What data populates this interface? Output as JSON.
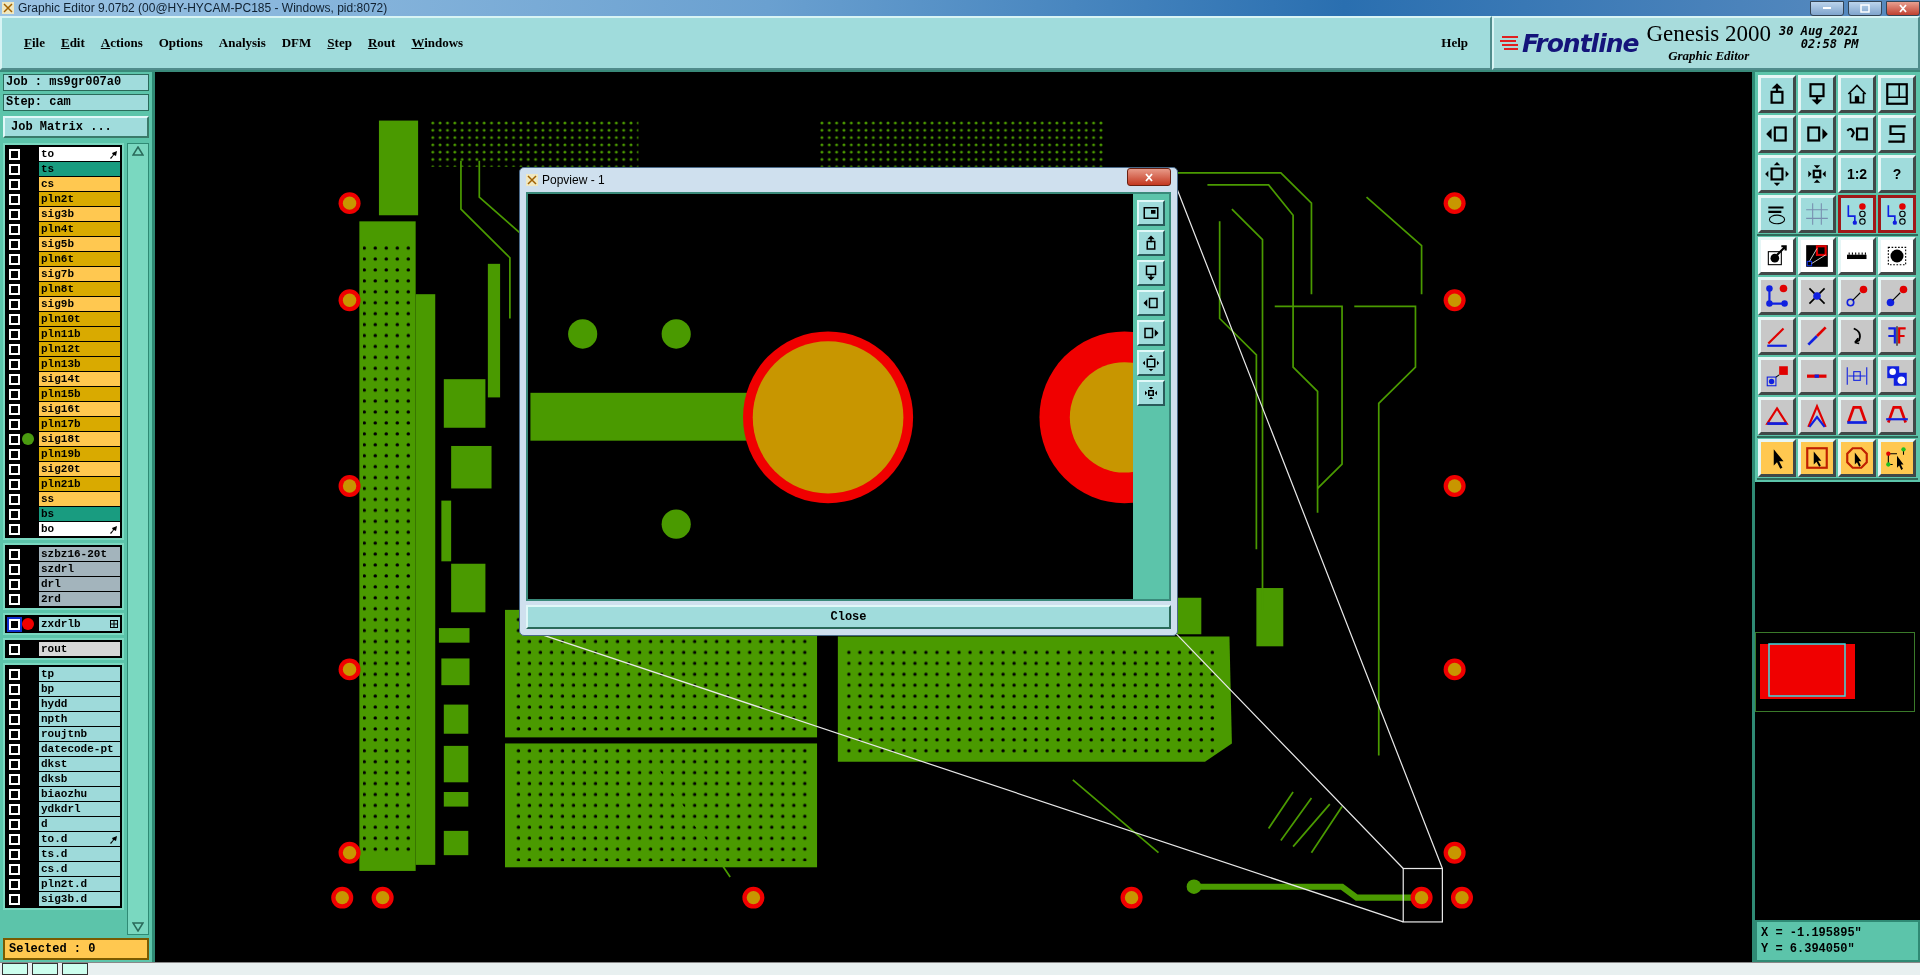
{
  "window": {
    "title": "Graphic Editor 9.07b2 (00@HY-HYCAM-PC185 - Windows, pid:8072)"
  },
  "menu": [
    {
      "label": "File",
      "underline": true
    },
    {
      "label": "Edit",
      "underline": true
    },
    {
      "label": "Actions",
      "underline": true
    },
    {
      "label": "Options",
      "underline": false
    },
    {
      "label": "Analysis",
      "underline": false
    },
    {
      "label": "DFM",
      "underline": false
    },
    {
      "label": "Step",
      "underline": true
    },
    {
      "label": "Rout",
      "underline": true
    },
    {
      "label": "Windows",
      "underline": true
    }
  ],
  "help": {
    "label": "Help"
  },
  "brand": {
    "logo": "Frontline",
    "product": "Genesis 2000",
    "subtitle": "Graphic Editor",
    "date": "30 Aug 2021",
    "time": "02:58 PM"
  },
  "job": {
    "job": "Job : ms9gr007a0",
    "step": "Step: cam",
    "matrix_button": "Job Matrix ..."
  },
  "layer_groups": [
    {
      "rows": [
        {
          "name": "to",
          "kind": "hand",
          "color": "#ffffff",
          "affected": false,
          "displayed": false,
          "work_layer": false
        },
        {
          "name": "ts",
          "kind": "plain",
          "color": "#199c80",
          "affected": false,
          "displayed": false,
          "work_layer": false
        },
        {
          "name": "cs",
          "kind": "plain",
          "color": "#ffc850",
          "affected": false,
          "displayed": false,
          "work_layer": false
        },
        {
          "name": "pln2t",
          "kind": "plain",
          "color": "#d9aa00",
          "affected": false,
          "displayed": false,
          "work_layer": false
        },
        {
          "name": "sig3b",
          "kind": "plain",
          "color": "#ffc850",
          "affected": false,
          "displayed": false,
          "work_layer": false
        },
        {
          "name": "pln4t",
          "kind": "plain",
          "color": "#d9aa00",
          "affected": false,
          "displayed": false,
          "work_layer": false
        },
        {
          "name": "sig5b",
          "kind": "plain",
          "color": "#ffc850",
          "affected": false,
          "displayed": false,
          "work_layer": false
        },
        {
          "name": "pln6t",
          "kind": "plain",
          "color": "#d9aa00",
          "affected": false,
          "displayed": false,
          "work_layer": false
        },
        {
          "name": "sig7b",
          "kind": "plain",
          "color": "#ffc850",
          "affected": false,
          "displayed": false,
          "work_layer": false
        },
        {
          "name": "pln8t",
          "kind": "plain",
          "color": "#d9aa00",
          "affected": false,
          "displayed": false,
          "work_layer": false
        },
        {
          "name": "sig9b",
          "kind": "plain",
          "color": "#ffc850",
          "affected": false,
          "displayed": false,
          "work_layer": false
        },
        {
          "name": "pln10t",
          "kind": "plain",
          "color": "#d9aa00",
          "affected": false,
          "displayed": false,
          "work_layer": false
        },
        {
          "name": "pln11b",
          "kind": "plain",
          "color": "#d9aa00",
          "affected": false,
          "displayed": false,
          "work_layer": false
        },
        {
          "name": "pln12t",
          "kind": "plain",
          "color": "#d9aa00",
          "affected": false,
          "displayed": false,
          "work_layer": false
        },
        {
          "name": "pln13b",
          "kind": "plain",
          "color": "#d9aa00",
          "affected": false,
          "displayed": false,
          "work_layer": false
        },
        {
          "name": "sig14t",
          "kind": "plain",
          "color": "#ffc850",
          "affected": false,
          "displayed": false,
          "work_layer": false
        },
        {
          "name": "pln15b",
          "kind": "plain",
          "color": "#d9aa00",
          "affected": false,
          "displayed": false,
          "work_layer": false
        },
        {
          "name": "sig16t",
          "kind": "plain",
          "color": "#ffc850",
          "affected": false,
          "displayed": false,
          "work_layer": false
        },
        {
          "name": "pln17b",
          "kind": "plain",
          "color": "#d9aa00",
          "affected": false,
          "displayed": false,
          "work_layer": false
        },
        {
          "name": "sig18t",
          "kind": "plain",
          "color": "#ffc850",
          "affected": false,
          "displayed": true,
          "work_layer": false
        },
        {
          "name": "pln19b",
          "kind": "plain",
          "color": "#d9aa00",
          "affected": false,
          "displayed": false,
          "work_layer": false
        },
        {
          "name": "sig20t",
          "kind": "plain",
          "color": "#ffc850",
          "affected": false,
          "displayed": false,
          "work_layer": false
        },
        {
          "name": "pln21b",
          "kind": "plain",
          "color": "#d9aa00",
          "affected": false,
          "displayed": false,
          "work_layer": false
        },
        {
          "name": "ss",
          "kind": "plain",
          "color": "#ffc850",
          "affected": false,
          "displayed": false,
          "work_layer": false
        },
        {
          "name": "bs",
          "kind": "plain",
          "color": "#199c80",
          "affected": false,
          "displayed": false,
          "work_layer": false
        },
        {
          "name": "bo",
          "kind": "hand",
          "color": "#ffffff",
          "affected": false,
          "displayed": false,
          "work_layer": false
        }
      ]
    },
    {
      "rows": [
        {
          "name": "szbz16-20t",
          "kind": "plain",
          "color": "#a3b4bc",
          "affected": false,
          "displayed": false,
          "work_layer": false
        },
        {
          "name": "szdrl",
          "kind": "plain",
          "color": "#a3b4bc",
          "affected": false,
          "displayed": false,
          "work_layer": false
        },
        {
          "name": "drl",
          "kind": "plain",
          "color": "#a3b4bc",
          "affected": false,
          "displayed": false,
          "work_layer": false
        },
        {
          "name": "2rd",
          "kind": "plain",
          "color": "#a3b4bc",
          "affected": false,
          "displayed": false,
          "work_layer": false
        }
      ]
    },
    {
      "rows": [
        {
          "name": "zxdrlb",
          "kind": "grid",
          "color": "#9edada",
          "affected": false,
          "displayed": false,
          "work_layer": true
        }
      ]
    },
    {
      "rows": [
        {
          "name": "rout",
          "kind": "plain",
          "color": "#d8d8d8",
          "affected": false,
          "displayed": false,
          "work_layer": false
        }
      ]
    },
    {
      "rows": [
        {
          "name": "tp",
          "kind": "plain",
          "color": "#9edada",
          "affected": false,
          "displayed": false,
          "work_layer": false
        },
        {
          "name": "bp",
          "kind": "plain",
          "color": "#9edada",
          "affected": false,
          "displayed": false,
          "work_layer": false
        },
        {
          "name": "hydd",
          "kind": "plain",
          "color": "#9edada",
          "affected": false,
          "displayed": false,
          "work_layer": false
        },
        {
          "name": "npth",
          "kind": "plain",
          "color": "#9edada",
          "affected": false,
          "displayed": false,
          "work_layer": false
        },
        {
          "name": "roujtnb",
          "kind": "plain",
          "color": "#9edada",
          "affected": false,
          "displayed": false,
          "work_layer": false
        },
        {
          "name": "datecode-pt",
          "kind": "plain",
          "color": "#9edada",
          "affected": false,
          "displayed": false,
          "work_layer": false
        },
        {
          "name": "dkst",
          "kind": "plain",
          "color": "#9edada",
          "affected": false,
          "displayed": false,
          "work_layer": false
        },
        {
          "name": "dksb",
          "kind": "plain",
          "color": "#9edada",
          "affected": false,
          "displayed": false,
          "work_layer": false
        },
        {
          "name": "biaozhu",
          "kind": "plain",
          "color": "#9edada",
          "affected": false,
          "displayed": false,
          "work_layer": false
        },
        {
          "name": "ydkdrl",
          "kind": "plain",
          "color": "#9edada",
          "affected": false,
          "displayed": false,
          "work_layer": false
        },
        {
          "name": "d",
          "kind": "plain",
          "color": "#9edada",
          "affected": false,
          "displayed": false,
          "work_layer": false
        },
        {
          "name": "to.d",
          "kind": "hand",
          "color": "#9edada",
          "affected": false,
          "displayed": false,
          "work_layer": false
        },
        {
          "name": "ts.d",
          "kind": "plain",
          "color": "#9edada",
          "affected": false,
          "displayed": false,
          "work_layer": false
        },
        {
          "name": "cs.d",
          "kind": "plain",
          "color": "#9edada",
          "affected": false,
          "displayed": false,
          "work_layer": false
        },
        {
          "name": "pln2t.d",
          "kind": "plain",
          "color": "#9edada",
          "affected": false,
          "displayed": false,
          "work_layer": false
        },
        {
          "name": "sig3b.d",
          "kind": "plain",
          "color": "#9edada",
          "affected": false,
          "displayed": false,
          "work_layer": false
        }
      ]
    }
  ],
  "selected_count": "Selected : 0",
  "popview": {
    "title": "Popview - 1",
    "close_button": "Close",
    "tools": [
      {
        "kind": "window-fit"
      },
      {
        "kind": "box-arrow-up"
      },
      {
        "kind": "box-arrow-down"
      },
      {
        "kind": "box-arrow-left"
      },
      {
        "kind": "box-arrow-right"
      },
      {
        "kind": "box-arrows-out"
      },
      {
        "kind": "box-arrows-in"
      }
    ]
  },
  "toolbar": [
    {
      "kind": "view",
      "buttons": [
        {
          "kind": "box-arrow-up",
          "selected": false
        },
        {
          "kind": "box-arrow-down",
          "selected": false
        },
        {
          "kind": "house",
          "selected": false
        },
        {
          "kind": "window-grid",
          "selected": false
        },
        {
          "kind": "box-arrow-left",
          "selected": false
        },
        {
          "kind": "box-arrow-right",
          "selected": false
        },
        {
          "kind": "undo-box",
          "selected": false
        },
        {
          "kind": "s-curve",
          "selected": false
        },
        {
          "kind": "box-arrows-out",
          "selected": false
        },
        {
          "kind": "box-arrows-in",
          "selected": false
        },
        {
          "kind": "text",
          "label": "1:2",
          "selected": false
        },
        {
          "kind": "text",
          "label": "?",
          "selected": false
        },
        {
          "kind": "wrench-palette",
          "selected": false
        },
        {
          "kind": "grid",
          "selected": false
        },
        {
          "kind": "circuit",
          "selected": true
        },
        {
          "kind": "circuit",
          "selected": true
        }
      ]
    },
    {
      "kind": "edit",
      "buttons": [
        {
          "kind": "pad-arrow",
          "selected": false
        },
        {
          "kind": "zoom-window",
          "selected": false
        },
        {
          "kind": "ruler",
          "selected": false
        },
        {
          "kind": "dashed-pad",
          "selected": false
        },
        {
          "kind": "nodes",
          "selected": false
        },
        {
          "kind": "cross-dot",
          "selected": false
        },
        {
          "kind": "dot-link-hollow",
          "selected": false
        },
        {
          "kind": "dot-link",
          "selected": false
        },
        {
          "kind": "angle-line",
          "selected": false
        },
        {
          "kind": "diag-line",
          "selected": false
        },
        {
          "kind": "curl-arrow",
          "selected": false
        },
        {
          "kind": "mirror",
          "selected": false
        },
        {
          "kind": "square-link",
          "selected": false
        },
        {
          "kind": "dash-line",
          "selected": false
        },
        {
          "kind": "dimension",
          "selected": false
        },
        {
          "kind": "blob-shapes",
          "selected": false
        },
        {
          "kind": "triangle",
          "selected": false
        },
        {
          "kind": "double-triangle",
          "selected": false
        },
        {
          "kind": "arch",
          "selected": false
        },
        {
          "kind": "arch-cross",
          "selected": false
        }
      ]
    },
    {
      "kind": "select",
      "buttons": [
        {
          "kind": "pointer",
          "selected": false
        },
        {
          "kind": "pointer-square",
          "selected": false
        },
        {
          "kind": "pointer-octagon",
          "selected": false
        },
        {
          "kind": "pointer-net",
          "selected": false
        }
      ]
    }
  ],
  "coordinates": {
    "x": "X = -1.195895\"",
    "y": "Y = 6.394050\""
  }
}
